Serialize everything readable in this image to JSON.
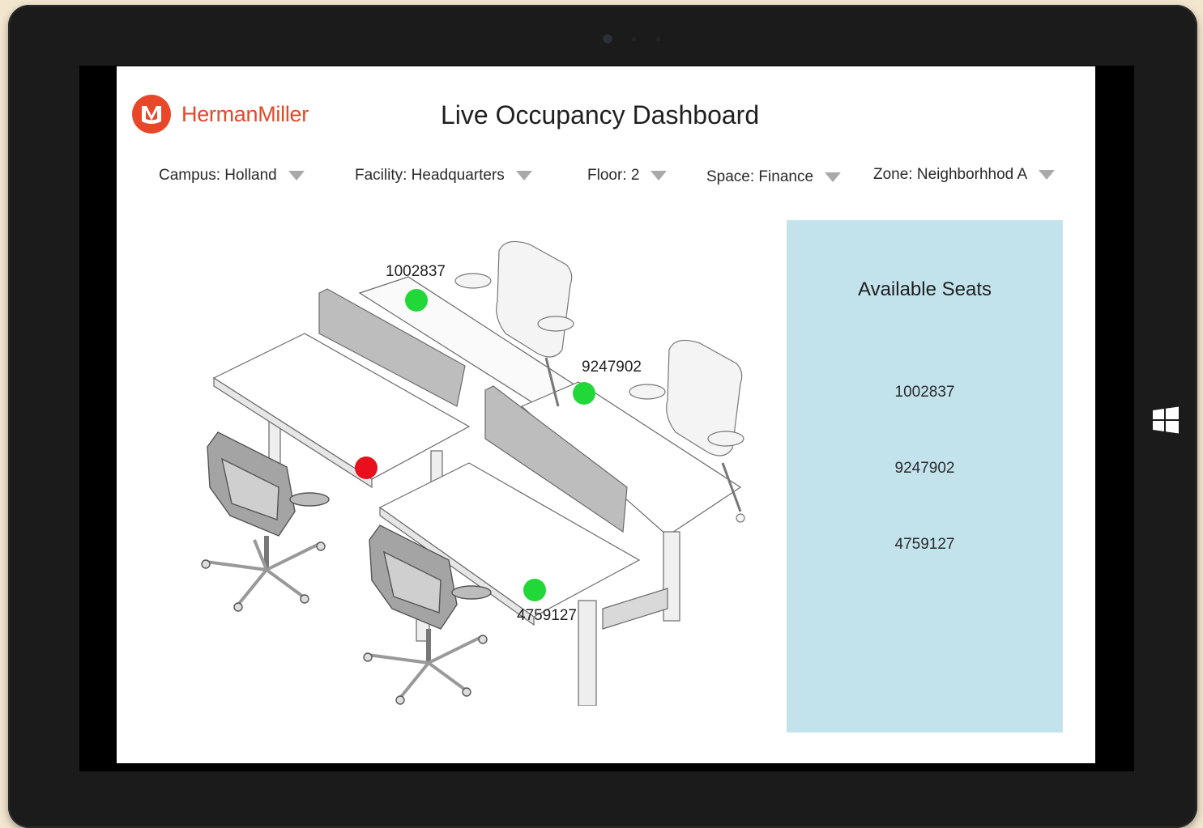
{
  "brand": {
    "name": "HermanMiller",
    "color": "#e8472a"
  },
  "header": {
    "title": "Live Occupancy Dashboard"
  },
  "filters": [
    {
      "label": "Campus: Holland"
    },
    {
      "label": "Facility: Headquarters"
    },
    {
      "label": "Floor: 2"
    },
    {
      "label": "Space: Finance"
    },
    {
      "label": "Zone: Neighborhhod A"
    }
  ],
  "diagram": {
    "seats": [
      {
        "id": "1002837",
        "status": "available",
        "color": "#22d838"
      },
      {
        "id": "9247902",
        "status": "available",
        "color": "#22d838"
      },
      {
        "id": "",
        "status": "occupied",
        "color": "#e8101c"
      },
      {
        "id": "4759127",
        "status": "available",
        "color": "#22d838"
      }
    ]
  },
  "panel": {
    "title": "Available Seats",
    "background": "#c3e3ec",
    "seats": [
      "1002837",
      "9247902",
      "4759127"
    ]
  },
  "os": {
    "start_icon": "windows-logo-icon"
  }
}
